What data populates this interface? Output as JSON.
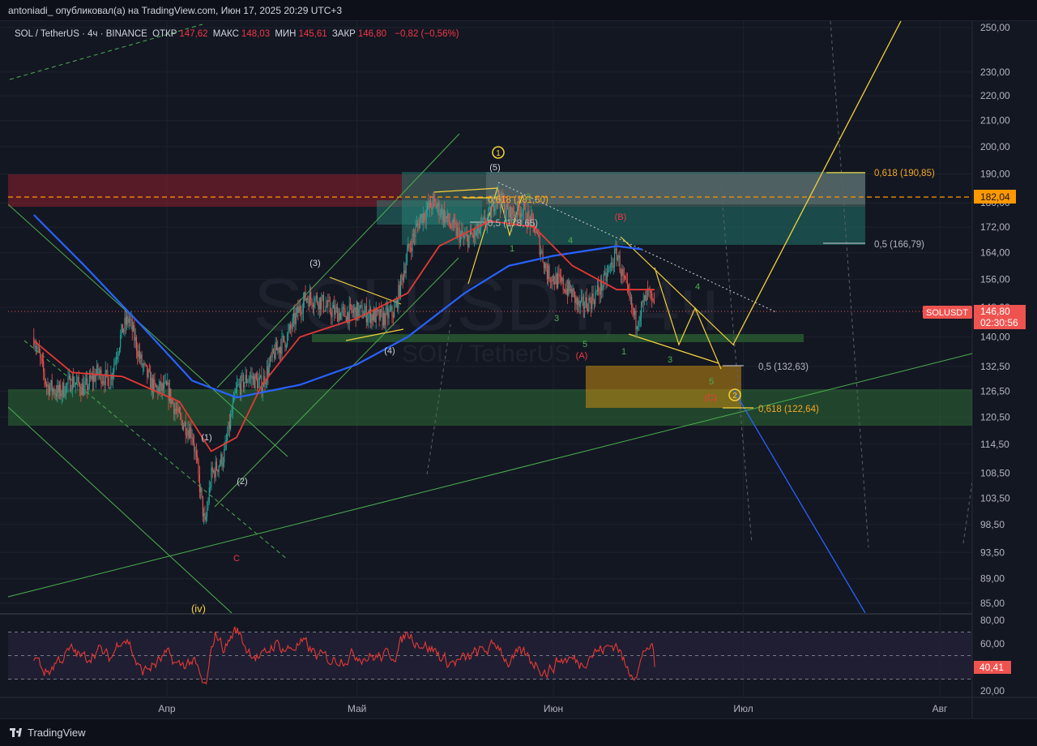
{
  "header": {
    "publish_line": "antoniadi_ опубликовал(а) на TradingView.com, Июн 17, 2025 20:29 UTC+3"
  },
  "legend": {
    "symbol": "SOL / TetherUS · 4ч · BINANCE",
    "open_label": "ОТКР",
    "open": "147,62",
    "high_label": "МАКС",
    "high": "148,03",
    "low_label": "МИН",
    "low": "145,61",
    "close_label": "ЗАКР",
    "close": "146,80",
    "change": "−0,82 (−0,56%)"
  },
  "watermark": {
    "ticker": "SOLUSDT, 4ч",
    "name": "SOL / TetherUS"
  },
  "price_axis": {
    "last_price_tag": "146,80",
    "countdown": "02:30:56",
    "symbol_tag": "SOLUSDT",
    "level_tag": "182,04"
  },
  "rsi_axis": {
    "value_tag": "40,41"
  },
  "fib_labels": [
    "0,618 (190,85)",
    "0,5 (166,79)",
    "0,5 (132,63)",
    "0,618 (122,64)",
    "0,618 (181,50)",
    "0,5 (178,65)"
  ],
  "wave_labels": {
    "c1": "1",
    "c2": "2",
    "w5": "(5)",
    "w3": "(3)",
    "w4": "(4)",
    "w1": "(1)",
    "w2": "(2)",
    "wiv": "(iv)",
    "wC": "C",
    "wB": "(B)",
    "wA": "(A)",
    "wCc": "(C)",
    "g1": "1",
    "g2": "2",
    "g3": "3",
    "g4": "4",
    "g5": "5",
    "h1": "1",
    "h3": "3",
    "h4": "4",
    "h5": "5",
    "i3": "3",
    "i4": "4",
    "i1": "1",
    "i5": "5"
  },
  "footer": {
    "brand": "TradingView"
  },
  "colors": {
    "bull": "#26a69a",
    "bear": "#ef5350",
    "ma_fast": "#e53935",
    "ma_slow": "#2962ff",
    "fib": "#f5d13b",
    "rsi": "#e53935"
  },
  "chart_data": {
    "type": "candlestick",
    "symbol": "SOL / TetherUS",
    "timeframe": "4ч",
    "exchange": "BINANCE",
    "scale": "log",
    "ylim": [
      82,
      262
    ],
    "y_ticks": [
      250,
      230,
      220,
      210,
      200,
      190,
      180,
      172,
      164,
      156,
      148,
      140,
      132.5,
      126.5,
      120.5,
      114.5,
      108.5,
      103.5,
      98.5,
      93.5,
      89,
      85
    ],
    "y_tick_labels": [
      "250,00",
      "230,00",
      "220,00",
      "210,00",
      "200,00",
      "190,00",
      "180,00",
      "172,00",
      "164,00",
      "156,00",
      "148,00",
      "140,00",
      "132,50",
      "126,50",
      "120,50",
      "114,50",
      "108,50",
      "103,50",
      "98,50",
      "93,50",
      "89,00",
      "85,00"
    ],
    "x_tick_labels": [
      "Апр",
      "Май",
      "Июн",
      "Июл",
      "Авг"
    ],
    "last_close": 146.8,
    "price_series": [
      [
        "2025-03-11",
        140
      ],
      [
        "2025-03-13",
        128
      ],
      [
        "2025-03-15",
        126
      ],
      [
        "2025-03-17",
        129
      ],
      [
        "2025-03-19",
        127
      ],
      [
        "2025-03-21",
        131
      ],
      [
        "2025-03-23",
        129
      ],
      [
        "2025-03-25",
        142
      ],
      [
        "2025-03-26",
        145
      ],
      [
        "2025-03-28",
        133
      ],
      [
        "2025-03-30",
        127
      ],
      [
        "2025-04-01",
        127
      ],
      [
        "2025-04-03",
        120
      ],
      [
        "2025-04-05",
        117
      ],
      [
        "2025-04-07",
        98
      ],
      [
        "2025-04-08",
        108
      ],
      [
        "2025-04-10",
        112
      ],
      [
        "2025-04-12",
        127
      ],
      [
        "2025-04-14",
        130
      ],
      [
        "2025-04-16",
        128
      ],
      [
        "2025-04-18",
        136
      ],
      [
        "2025-04-20",
        140
      ],
      [
        "2025-04-22",
        148
      ],
      [
        "2025-04-23",
        151
      ],
      [
        "2025-04-25",
        150
      ],
      [
        "2025-04-27",
        147
      ],
      [
        "2025-04-29",
        146
      ],
      [
        "2025-05-01",
        147
      ],
      [
        "2025-05-03",
        146
      ],
      [
        "2025-05-05",
        145
      ],
      [
        "2025-05-07",
        147
      ],
      [
        "2025-05-09",
        164
      ],
      [
        "2025-05-11",
        175
      ],
      [
        "2025-05-13",
        180
      ],
      [
        "2025-05-14",
        178
      ],
      [
        "2025-05-16",
        172
      ],
      [
        "2025-05-18",
        168
      ],
      [
        "2025-05-20",
        170
      ],
      [
        "2025-05-22",
        176
      ],
      [
        "2025-05-23",
        183
      ],
      [
        "2025-05-25",
        176
      ],
      [
        "2025-05-27",
        178
      ],
      [
        "2025-05-29",
        172
      ],
      [
        "2025-05-31",
        158
      ],
      [
        "2025-06-02",
        155
      ],
      [
        "2025-06-04",
        152
      ],
      [
        "2025-06-05",
        148
      ],
      [
        "2025-06-07",
        150
      ],
      [
        "2025-06-09",
        155
      ],
      [
        "2025-06-11",
        164
      ],
      [
        "2025-06-12",
        156
      ],
      [
        "2025-06-14",
        144
      ],
      [
        "2025-06-16",
        152
      ],
      [
        "2025-06-17",
        146.8
      ]
    ],
    "moving_averages": [
      {
        "name": "",
        "color": "#e53935",
        "values": [
          [
            "2025-03-11",
            139
          ],
          [
            "2025-03-17",
            131
          ],
          [
            "2025-03-25",
            130
          ],
          [
            "2025-04-03",
            124
          ],
          [
            "2025-04-08",
            113
          ],
          [
            "2025-04-12",
            116
          ],
          [
            "2025-04-16",
            128
          ],
          [
            "2025-04-22",
            140
          ],
          [
            "2025-05-01",
            145
          ],
          [
            "2025-05-09",
            152
          ],
          [
            "2025-05-14",
            166
          ],
          [
            "2025-05-22",
            174
          ],
          [
            "2025-05-29",
            172
          ],
          [
            "2025-06-04",
            160
          ],
          [
            "2025-06-11",
            153
          ],
          [
            "2025-06-17",
            153
          ]
        ]
      },
      {
        "name": "",
        "color": "#2962ff",
        "values": [
          [
            "2025-03-11",
            176
          ],
          [
            "2025-03-19",
            160
          ],
          [
            "2025-03-28",
            143
          ],
          [
            "2025-04-05",
            129
          ],
          [
            "2025-04-12",
            125
          ],
          [
            "2025-04-22",
            128
          ],
          [
            "2025-05-01",
            133
          ],
          [
            "2025-05-09",
            140
          ],
          [
            "2025-05-18",
            152
          ],
          [
            "2025-05-25",
            160
          ],
          [
            "2025-06-01",
            163
          ],
          [
            "2025-06-11",
            166
          ],
          [
            "2025-06-15",
            165
          ]
        ]
      }
    ],
    "fib_levels": [
      {
        "ratio": 0.618,
        "price": 190.85
      },
      {
        "ratio": 0.5,
        "price": 166.79
      },
      {
        "ratio": 0.5,
        "price": 132.63
      },
      {
        "ratio": 0.618,
        "price": 122.64
      },
      {
        "ratio": 0.618,
        "price": 181.5
      },
      {
        "ratio": 0.5,
        "price": 178.65
      }
    ],
    "horizontal_levels": [
      182.04
    ],
    "rsi": {
      "value": 40.41,
      "ylim": [
        18,
        84
      ],
      "y_tick_labels": [
        "80,00",
        "60,00",
        "40,00",
        "20,00"
      ],
      "bands": [
        30,
        50,
        70
      ]
    }
  }
}
